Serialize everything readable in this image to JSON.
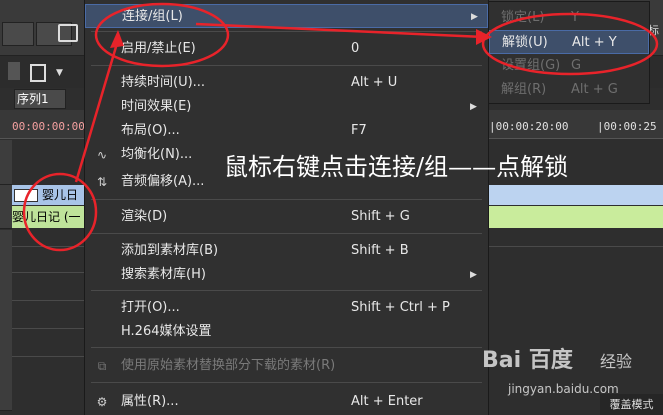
{
  "background": {
    "sequence_tab": "序列1",
    "timecode_left": "00:00:00:00",
    "timecode_mid": "|00:00:20:00",
    "timecode_right": "|00:00:25",
    "clip_video_title": "婴儿日",
    "clip_audio_title": "婴儿日记 (一",
    "right_edge_text": "标",
    "status_bar_text": "覆盖模式"
  },
  "context_menu": {
    "items": [
      {
        "label": "连接/组(L)",
        "shortcut": "",
        "icon": "",
        "arrow": true,
        "disabled": false,
        "highlighted": true
      },
      {
        "label": "启用/禁止(E)",
        "shortcut": "0",
        "icon": "",
        "arrow": false,
        "disabled": false,
        "highlighted": false
      },
      {
        "label": "持续时间(U)...",
        "shortcut": "Alt + U",
        "icon": "",
        "arrow": false,
        "disabled": false,
        "highlighted": false
      },
      {
        "label": "时间效果(E)",
        "shortcut": "",
        "icon": "",
        "arrow": true,
        "disabled": false,
        "highlighted": false
      },
      {
        "label": "布局(O)...",
        "shortcut": "F7",
        "icon": "",
        "arrow": false,
        "disabled": false,
        "highlighted": false
      },
      {
        "label": "均衡化(N)...",
        "shortcut": "",
        "icon": "equalizer-icon",
        "arrow": false,
        "disabled": false,
        "highlighted": false
      },
      {
        "label": "音频偏移(A)...",
        "shortcut": "",
        "icon": "audio-offset-icon",
        "arrow": false,
        "disabled": false,
        "highlighted": false
      },
      {
        "label": "渲染(D)",
        "shortcut": "Shift + G",
        "icon": "",
        "arrow": false,
        "disabled": false,
        "highlighted": false
      },
      {
        "label": "添加到素材库(B)",
        "shortcut": "Shift + B",
        "icon": "",
        "arrow": false,
        "disabled": false,
        "highlighted": false
      },
      {
        "label": "搜索素材库(H)",
        "shortcut": "",
        "icon": "",
        "arrow": true,
        "disabled": false,
        "highlighted": false
      },
      {
        "label": "打开(O)...",
        "shortcut": "Shift + Ctrl + P",
        "icon": "",
        "arrow": false,
        "disabled": false,
        "highlighted": false
      },
      {
        "label": "H.264媒体设置",
        "shortcut": "",
        "icon": "",
        "arrow": false,
        "disabled": false,
        "highlighted": false
      },
      {
        "label": "使用原始素材替换部分下载的素材(R)",
        "shortcut": "",
        "icon": "replace-clip-icon",
        "arrow": false,
        "disabled": true,
        "highlighted": false
      },
      {
        "label": "属性(R)...",
        "shortcut": "Alt + Enter",
        "icon": "properties-icon",
        "arrow": false,
        "disabled": false,
        "highlighted": false
      }
    ]
  },
  "submenu": {
    "items": [
      {
        "label": "锁定(L)",
        "shortcut": "Y",
        "disabled": true,
        "highlighted": false
      },
      {
        "label": "解锁(U)",
        "shortcut": "Alt + Y",
        "disabled": false,
        "highlighted": true
      },
      {
        "label": "设置组(G)",
        "shortcut": "G",
        "disabled": true,
        "highlighted": false
      },
      {
        "label": "解组(R)",
        "shortcut": "Alt + G",
        "disabled": true,
        "highlighted": false
      }
    ]
  },
  "annotation": {
    "caption": "鼠标右键点击连接/组——点解锁",
    "color": "#e8232a"
  },
  "watermark": {
    "logo_text": "Bai 百度",
    "brand": "经验",
    "url": "jingyan.baidu.com"
  }
}
